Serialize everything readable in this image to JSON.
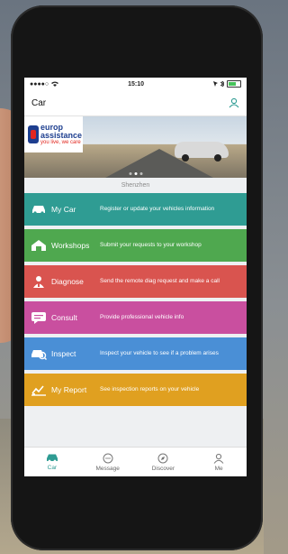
{
  "status_bar": {
    "signal": "●●●●○",
    "time": "15:10"
  },
  "navbar": {
    "title": "Car"
  },
  "banner": {
    "logo_line1": "europ",
    "logo_line2": "assistance",
    "logo_tagline": "you live, we care"
  },
  "location": "Shenzhen",
  "menu": [
    {
      "label": "My Car",
      "description": "Register or update your vehicles information",
      "color": "#2f9c93",
      "icon": "car-icon"
    },
    {
      "label": "Workshops",
      "description": "Submit your requests to your workshop",
      "color": "#4fa84f",
      "icon": "workshop-icon"
    },
    {
      "label": "Diagnose",
      "description": "Send the remote diag request and make a call",
      "color": "#d9544f",
      "icon": "diagnose-icon"
    },
    {
      "label": "Consult",
      "description": "Provide professional vehicle info",
      "color": "#c94f9f",
      "icon": "consult-icon"
    },
    {
      "label": "Inspect",
      "description": "Inspect your vehicle to see if a problem arises",
      "color": "#4a8fd6",
      "icon": "inspect-icon"
    },
    {
      "label": "My Report",
      "description": "See inspection reports on your vehicle",
      "color": "#e0a020",
      "icon": "report-icon"
    }
  ],
  "tabs": [
    {
      "label": "Car",
      "icon": "car-tab-icon",
      "active": true
    },
    {
      "label": "Message",
      "icon": "message-tab-icon",
      "active": false
    },
    {
      "label": "Discover",
      "icon": "compass-tab-icon",
      "active": false
    },
    {
      "label": "Me",
      "icon": "person-tab-icon",
      "active": false
    }
  ],
  "accent_color": "#2f9c93"
}
